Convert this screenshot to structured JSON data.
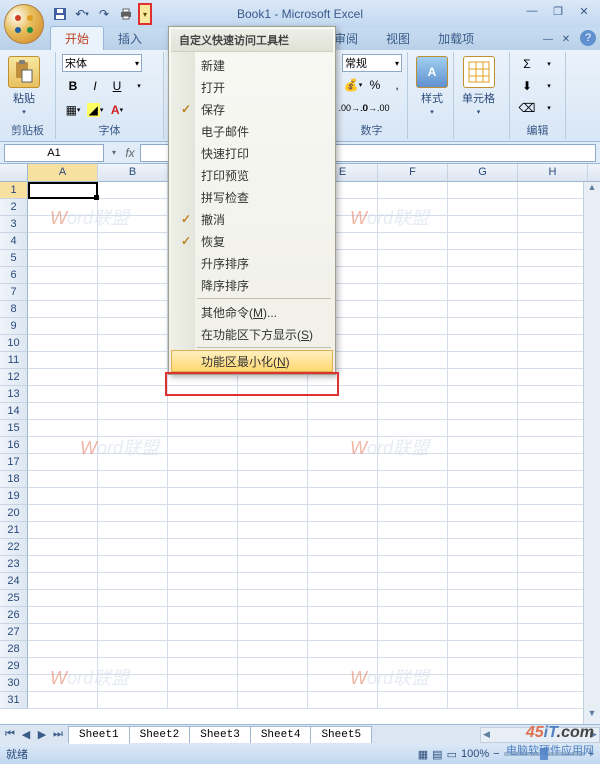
{
  "title": "Book1 - Microsoft Excel",
  "qat": {
    "save": "save-icon",
    "undo": "undo-icon",
    "redo": "redo-icon",
    "quickprint": "quickprint-icon"
  },
  "tabs": [
    "开始",
    "插入",
    "审阅",
    "视图",
    "加载项"
  ],
  "active_tab": "开始",
  "ribbon": {
    "clipboard": {
      "label": "剪贴板",
      "paste": "粘贴"
    },
    "font": {
      "label": "字体",
      "name": "宋体",
      "bold": "B",
      "italic": "I",
      "underline": "U"
    },
    "number": {
      "label": "数字",
      "format": "常规"
    },
    "styles": {
      "label": "样式",
      "style_btn": "样式"
    },
    "cells": {
      "label": "单元格",
      "cell_btn": "单元格"
    },
    "editing": {
      "label": "编辑",
      "sigma": "Σ"
    }
  },
  "namebox": "A1",
  "columns": [
    "A",
    "B",
    "C",
    "D",
    "E",
    "F",
    "G",
    "H"
  ],
  "row_count": 31,
  "active_cell": {
    "row": 1,
    "col": "A"
  },
  "sheets": [
    "Sheet1",
    "Sheet2",
    "Sheet3",
    "Sheet4",
    "Sheet5"
  ],
  "active_sheet": "Sheet1",
  "status": "就绪",
  "zoom": "100%",
  "dropdown": {
    "title": "自定义快速访问工具栏",
    "items": [
      {
        "label": "新建",
        "checked": false
      },
      {
        "label": "打开",
        "checked": false
      },
      {
        "label": "保存",
        "checked": true
      },
      {
        "label": "电子邮件",
        "checked": false
      },
      {
        "label": "快速打印",
        "checked": false
      },
      {
        "label": "打印预览",
        "checked": false
      },
      {
        "label": "拼写检查",
        "checked": false
      },
      {
        "label": "撤消",
        "checked": true
      },
      {
        "label": "恢复",
        "checked": true
      },
      {
        "label": "升序排序",
        "checked": false
      },
      {
        "label": "降序排序",
        "checked": false
      }
    ],
    "more_commands": "其他命令(M)...",
    "show_below": "在功能区下方显示(S)",
    "minimize_ribbon": "功能区最小化(N)"
  },
  "watermark45": {
    "brand": "45iT.com",
    "sub": "电脑软硬件应用网"
  }
}
